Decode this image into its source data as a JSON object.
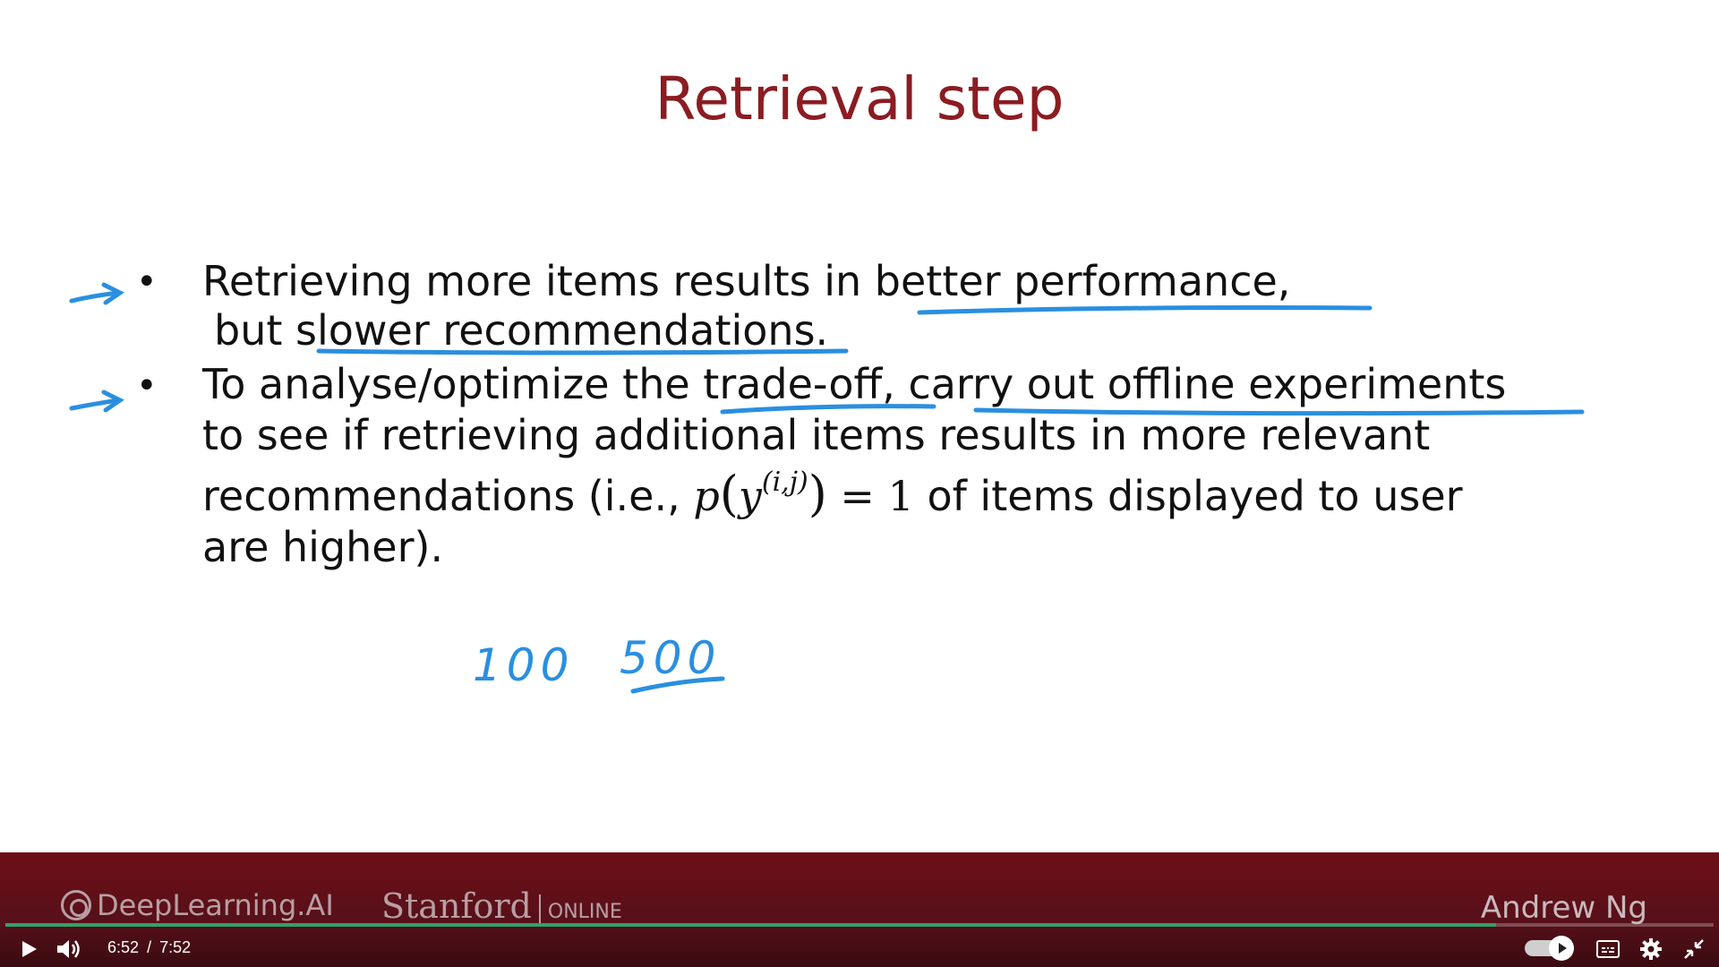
{
  "slide": {
    "title": "Retrieval step",
    "bullets": [
      {
        "lines": [
          "Retrieving more items results in better performance,",
          "but slower recommendations."
        ]
      },
      {
        "lines": [
          "To analyse/optimize the trade-off, carry out offline experiments",
          "to see if retrieving additional items results in more relevant"
        ],
        "line3_prefix": "recommendations (i.e., ",
        "math": {
          "p": "p",
          "y": "y",
          "sup": "(i,j)",
          "equals": " = 1"
        },
        "line3_suffix": " of items displayed to user",
        "line4": "are higher)."
      }
    ],
    "bullet_symbol": "•",
    "handwriting": [
      "100",
      "500"
    ],
    "ink_color": "#2a8fe0",
    "title_color": "#8b1c22"
  },
  "footer": {
    "brand_left": "DeepLearning.AI",
    "brand_stanford": "Stanford",
    "brand_online": "ONLINE",
    "presenter": "Andrew Ng"
  },
  "player": {
    "current_time": "6:52",
    "separator": "/",
    "duration": "7:52",
    "progress_fraction": 0.8729,
    "accent_color": "#2ea36a",
    "icons": [
      "play-icon",
      "volume-icon",
      "autoplay-toggle",
      "captions-icon",
      "settings-icon",
      "exit-fullscreen-icon"
    ]
  }
}
